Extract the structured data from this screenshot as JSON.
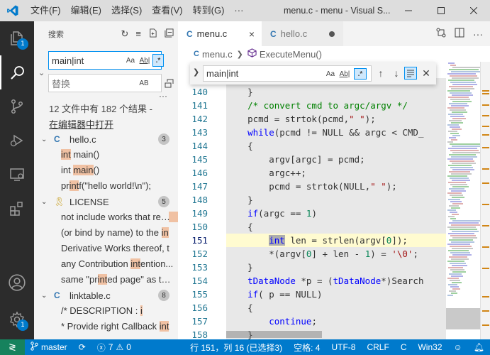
{
  "titlebar": {
    "menu": [
      "文件(F)",
      "编辑(E)",
      "选择(S)",
      "查看(V)",
      "转到(G)",
      "···"
    ],
    "title": "menu.c - menu - Visual S...",
    "controls": [
      "minimize-icon",
      "maximize-icon",
      "close-icon"
    ]
  },
  "activity": {
    "explorer_badge": "1",
    "settings_badge": "1"
  },
  "search": {
    "header": "搜索",
    "query": "main|int",
    "replace_placeholder": "替换",
    "opt_case": "Aa",
    "opt_word": "Ab|",
    "opt_regex": ".*",
    "opt_preserve_case": "AB",
    "summary": "12 文件中有 182 个结果 -",
    "open_in_editor": "在编辑器中打开",
    "more": "···"
  },
  "results": [
    {
      "file": "hello.c",
      "type": "c",
      "count": "3",
      "matches": [
        {
          "pre": "",
          "hit": "int",
          "post": " main()"
        },
        {
          "pre": "int ",
          "hit": "main",
          "post": "()"
        },
        {
          "pre": "pr",
          "hit": "int",
          "post": "f(\"hello world!\\n\");"
        }
      ]
    },
    {
      "file": "LICENSE",
      "type": "license",
      "count": "5",
      "matches": [
        {
          "pre": "not include works that rem",
          "hit": "ain",
          "post": ""
        },
        {
          "pre": "(or bind by name) to the ",
          "hit": "in",
          "post": ""
        },
        {
          "pre": "Derivative Works thereof, t",
          "hit": "",
          "post": ""
        },
        {
          "pre": "any Contribution ",
          "hit": "int",
          "post": "ention..."
        },
        {
          "pre": "same \"pr",
          "hit": "int",
          "post": "ed page\" as the..."
        }
      ]
    },
    {
      "file": "linktable.c",
      "type": "c",
      "count": "8",
      "matches": [
        {
          "pre": "/*  DESCRIPTION       : ",
          "hit": "i",
          "post": ""
        },
        {
          "pre": "* Provide right Callback ",
          "hit": "int",
          "post": ""
        }
      ]
    }
  ],
  "tabs": [
    {
      "label": "menu.c",
      "active": true,
      "close": "×"
    },
    {
      "label": "hello.c",
      "active": false
    }
  ],
  "breadcrumb": {
    "file": "menu.c",
    "symbol": "ExecuteMenu()"
  },
  "find": {
    "query": "main|int",
    "opt_case": "Aa",
    "opt_word": "Ab|",
    "opt_regex": ".*"
  },
  "editor": {
    "current_line": 151,
    "lines": [
      {
        "n": "140",
        "html": "<span style='padding-left:0'>    }</span>"
      },
      {
        "n": "141",
        "html": "    <span class='cm'>/* convert cmd to argc/argv */</span>"
      },
      {
        "n": "142",
        "html": "    pcmd = strtok(pcmd,<span class='str'>\" \"</span>);"
      },
      {
        "n": "143",
        "html": "    <span class='kw'>while</span>(pcmd != NULL &amp;&amp; argc &lt; CMD_"
      },
      {
        "n": "144",
        "html": "    {"
      },
      {
        "n": "145",
        "html": "        argv[argc] = pcmd;"
      },
      {
        "n": "146",
        "html": "        argc++;"
      },
      {
        "n": "147",
        "html": "        pcmd = strtok(NULL,<span class='str'>\" \"</span>);"
      },
      {
        "n": "148",
        "html": "    }"
      },
      {
        "n": "149",
        "html": "    <span class='kw'>if</span>(argc == <span class='num'>1</span>)"
      },
      {
        "n": "150",
        "html": "    {"
      },
      {
        "n": "151",
        "html": "        <span class='kw sel-word'>int</span> len = strlen(argv[<span class='num'>0</span>]);"
      },
      {
        "n": "152",
        "html": "        *(argv[<span class='num'>0</span>] + len - <span class='num'>1</span>) = <span class='str'>'\\0'</span>;"
      },
      {
        "n": "153",
        "html": "    }"
      },
      {
        "n": "154",
        "html": "    <span class='kw'>tDataNode</span> *p = (<span class='kw'>tDataNode</span>*)Search"
      },
      {
        "n": "155",
        "html": "    <span class='kw'>if</span>( p == NULL)"
      },
      {
        "n": "156",
        "html": "    {"
      },
      {
        "n": "157",
        "html": "        <span class='kw'>continue</span>;"
      },
      {
        "n": "158",
        "html": "    }"
      }
    ]
  },
  "status": {
    "branch": "master",
    "errors": "7",
    "warnings": "0",
    "position": "行 151，列 16 (已选择3)",
    "spaces": "空格: 4",
    "encoding": "UTF-8",
    "eol": "CRLF",
    "language": "C",
    "platform": "Win32"
  },
  "colors": {
    "accent": "#007acc",
    "remote": "#16825d",
    "match_highlight": "#f6b48c"
  }
}
